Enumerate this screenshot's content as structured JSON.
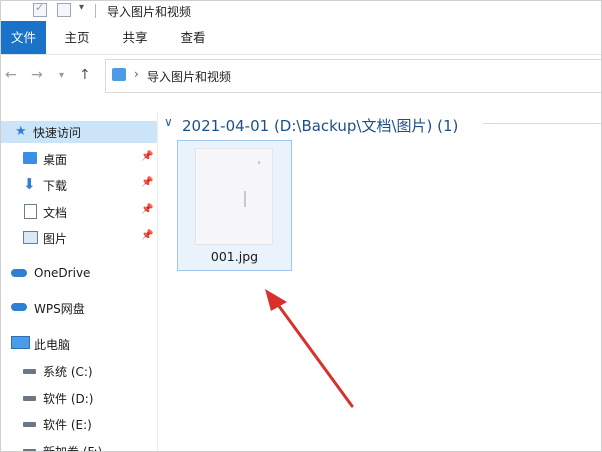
{
  "window": {
    "title": "导入图片和视频"
  },
  "ribbon": {
    "tabs": [
      {
        "label": "文件"
      },
      {
        "label": "主页"
      },
      {
        "label": "共享"
      },
      {
        "label": "查看"
      }
    ]
  },
  "navigation": {
    "path": "导入图片和视频"
  },
  "sidebar": {
    "quick_access": "快速访问",
    "items": [
      {
        "label": "桌面",
        "icon": "desktop-icon"
      },
      {
        "label": "下载",
        "icon": "download-icon"
      },
      {
        "label": "文档",
        "icon": "document-icon"
      },
      {
        "label": "图片",
        "icon": "picture-icon"
      }
    ],
    "onedrive": "OneDrive",
    "wps": "WPS网盘",
    "this_pc": "此电脑",
    "drives": [
      {
        "label": "系统 (C:)"
      },
      {
        "label": "软件 (D:)"
      },
      {
        "label": "软件 (E:)"
      },
      {
        "label": "新加卷 (F:)"
      }
    ]
  },
  "content": {
    "group_title": "2021-04-01 (D:\\Backup\\文档\\图片) (1)",
    "files": [
      {
        "name": "001.jpg"
      }
    ]
  },
  "colors": {
    "accent": "#1a73c8",
    "selected": "#cce4f7",
    "group_title": "#1e4f8a",
    "annotation_arrow": "#d9302c"
  }
}
